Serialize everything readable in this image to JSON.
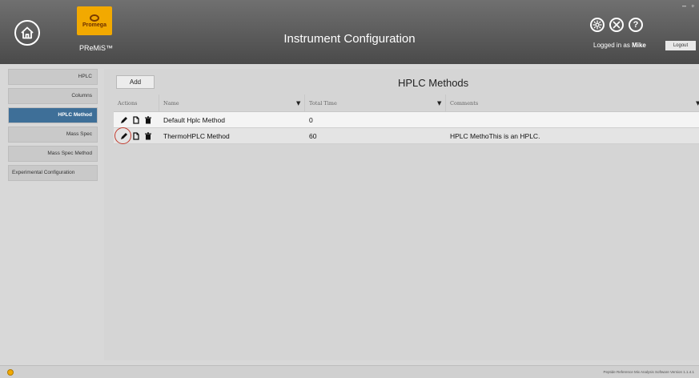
{
  "header": {
    "logo_text": "Promega",
    "app_name": "PReMiS™",
    "title": "Instrument Configuration",
    "icons": [
      "gear-icon",
      "tools-icon",
      "help-icon"
    ],
    "window_controls": "– ▫",
    "login_prefix": "Logged in as",
    "user": "Mike",
    "logout_label": "Logout"
  },
  "sidebar": {
    "items": [
      {
        "label": "HPLC",
        "active": false
      },
      {
        "label": "Columns",
        "active": false
      },
      {
        "label": "HPLC Method",
        "active": true
      },
      {
        "label": "Mass Spec",
        "active": false
      },
      {
        "label": "Mass Spec Method",
        "active": false
      },
      {
        "label": "Experimental Configuration",
        "active": false
      }
    ]
  },
  "main": {
    "add_label": "Add",
    "section_title": "HPLC Methods",
    "columns": {
      "actions": "Actions",
      "name": "Name",
      "total_time": "Total Time",
      "comments": "Comments"
    },
    "rows": [
      {
        "name": "Default Hplc Method",
        "total_time": "0",
        "comments": ""
      },
      {
        "name": "ThermoHPLC Method",
        "total_time": "60",
        "comments": "HPLC MethoThis is an HPLC."
      }
    ]
  },
  "footer": {
    "version": "Peptide Reference Mix Analysis Software Version 1.1.4.1"
  }
}
